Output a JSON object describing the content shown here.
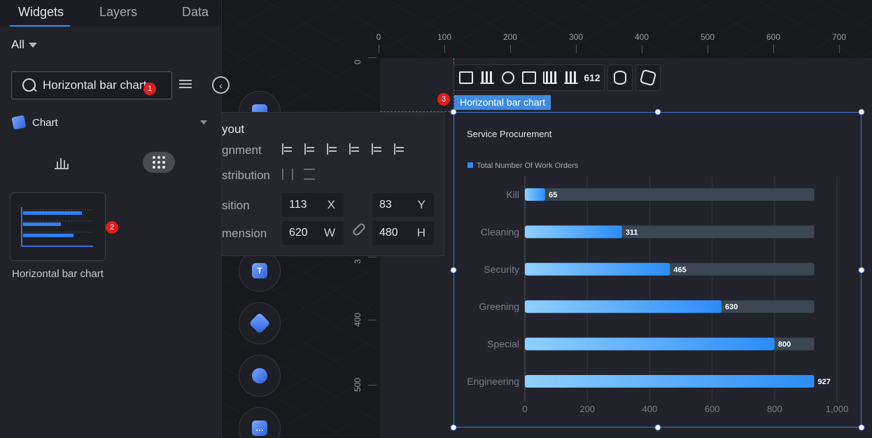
{
  "tabs": [
    {
      "label": "Widgets",
      "active": true
    },
    {
      "label": "Layers",
      "active": false
    },
    {
      "label": "Data",
      "active": false
    }
  ],
  "filter": {
    "label": "All"
  },
  "search": {
    "value": "Horizontal bar chart"
  },
  "category": {
    "label": "Chart"
  },
  "widget": {
    "label": "Horizontal bar chart"
  },
  "markers": [
    "1",
    "2",
    "3"
  ],
  "ruler": {
    "h_labels": [
      "0",
      "100",
      "200",
      "300",
      "400",
      "500",
      "600",
      "700"
    ],
    "v_labels": [
      "0",
      "3",
      "400",
      "500"
    ]
  },
  "layout_panel": {
    "title": "yout",
    "alignment_label": "gnment",
    "distribution_label": "stribution",
    "position_label": "sition",
    "dimension_label": "mension",
    "x": {
      "value": "113",
      "unit": "X"
    },
    "y": {
      "value": "83",
      "unit": "Y"
    },
    "w": {
      "value": "620",
      "unit": "W"
    },
    "h": {
      "value": "480",
      "unit": "H"
    }
  },
  "toolbar": {
    "number_icon": "612"
  },
  "selection_tag": "Horizontal bar chart",
  "colors": {
    "accent": "#3d8cff",
    "bar_start": "#8fd0ff",
    "bar_end": "#2b8cf7",
    "track": "#3b4752",
    "marker": "#e01e1e"
  },
  "chart_data": {
    "type": "bar",
    "orientation": "horizontal",
    "title": "Service Procurement",
    "legend": "Total Number Of Work Orders",
    "legend_position": "top-left",
    "categories": [
      "Kill",
      "Cleaning",
      "Security",
      "Greening",
      "Special",
      "Engineering"
    ],
    "series": [
      {
        "name": "Total Number Of Work Orders",
        "values": [
          65,
          311,
          465,
          630,
          800,
          927
        ]
      }
    ],
    "max": 927,
    "xlim": [
      0,
      1000
    ],
    "x_ticks": [
      "0",
      "200",
      "400",
      "600",
      "800",
      "1,000"
    ],
    "grid": true
  }
}
